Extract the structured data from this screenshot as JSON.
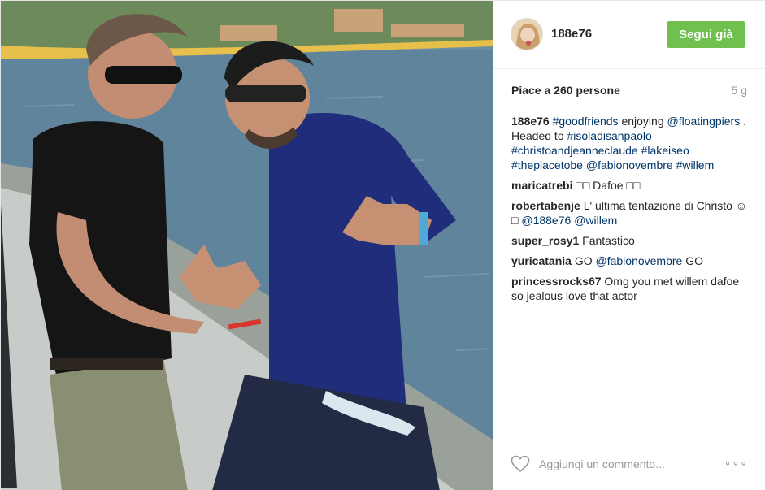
{
  "header": {
    "username": "188e76",
    "follow_label": "Segui già"
  },
  "stats": {
    "likes_text": "Piace a 260 persone",
    "age": "5 g"
  },
  "caption": {
    "user": "188e76",
    "parts": [
      {
        "text": "#goodfriends",
        "tag": true
      },
      {
        "text": " enjoying ",
        "tag": false
      },
      {
        "text": "@floatingpiers",
        "tag": true
      },
      {
        "text": " . Headed to ",
        "tag": false
      },
      {
        "text": "#isoladisanpaolo",
        "tag": true
      },
      {
        "text": " ",
        "tag": false
      },
      {
        "text": "#christoandjeanneclaude",
        "tag": true
      },
      {
        "text": " ",
        "tag": false
      },
      {
        "text": "#lakeiseo",
        "tag": true
      },
      {
        "text": " ",
        "tag": false
      },
      {
        "text": "#theplacetobe",
        "tag": true
      },
      {
        "text": " ",
        "tag": false
      },
      {
        "text": "@fabionovembre",
        "tag": true
      },
      {
        "text": " ",
        "tag": false
      },
      {
        "text": "#willem",
        "tag": true
      }
    ]
  },
  "comments": [
    {
      "user": "maricatrebi",
      "parts": [
        {
          "text": "□□ Dafoe □□",
          "tag": false
        }
      ]
    },
    {
      "user": "robertabenje",
      "parts": [
        {
          "text": "L' ultima tentazione di Christo ☺□ ",
          "tag": false
        },
        {
          "text": "@188e76",
          "tag": true
        },
        {
          "text": " ",
          "tag": false
        },
        {
          "text": "@willem",
          "tag": true
        }
      ]
    },
    {
      "user": "super_rosy1",
      "parts": [
        {
          "text": "Fantastico",
          "tag": false
        }
      ]
    },
    {
      "user": "yuricatania",
      "parts": [
        {
          "text": "GO ",
          "tag": false
        },
        {
          "text": "@fabionovembre",
          "tag": true
        },
        {
          "text": " GO",
          "tag": false
        }
      ]
    },
    {
      "user": "princessrocks67",
      "parts": [
        {
          "text": "Omg you met willem dafoe so jealous love that actor",
          "tag": false
        }
      ]
    }
  ],
  "footer": {
    "comment_placeholder": "Aggiungi un commento...",
    "more_label": "∘∘∘",
    "heart_icon": "heart-outline-icon"
  },
  "colors": {
    "follow_button": "#70c050",
    "hashtag": "#003569",
    "muted": "#999999"
  }
}
